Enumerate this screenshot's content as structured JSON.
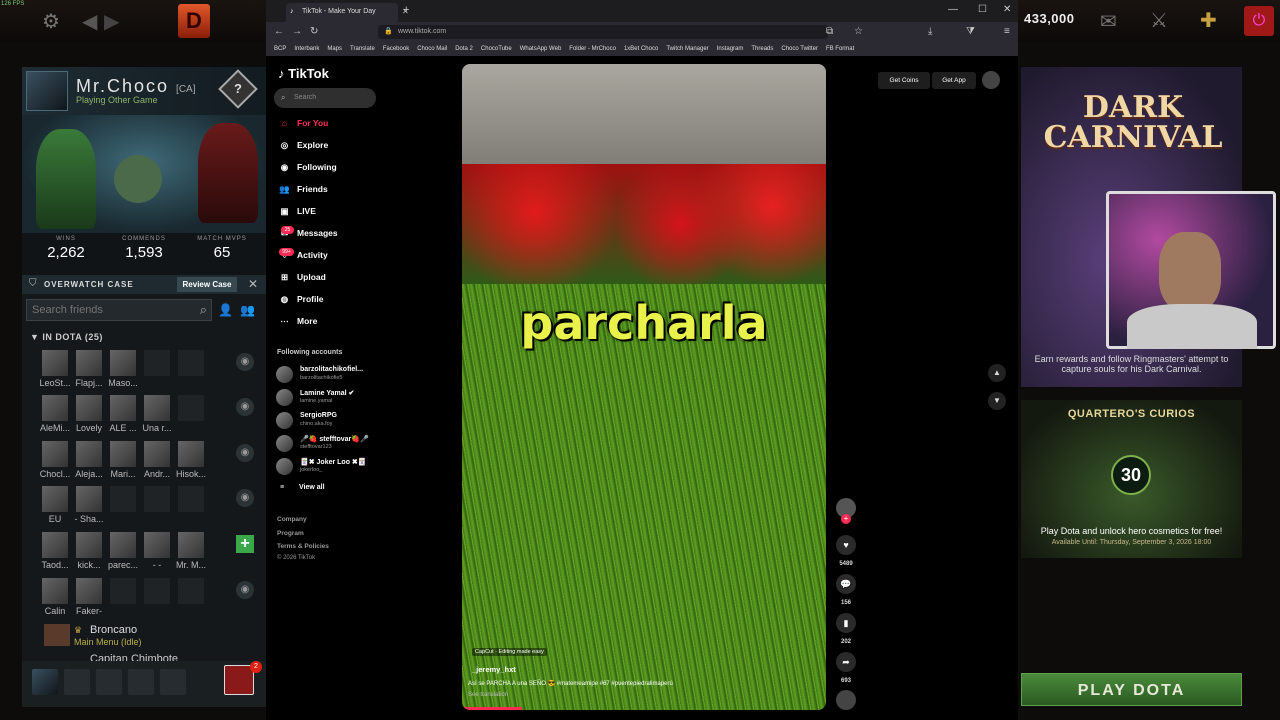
{
  "fps": "126 FPS",
  "dota": {
    "gold": "433,000",
    "profile": {
      "name": "Mr.Choco",
      "tag": "[CA]",
      "status": "Playing Other Game",
      "rank_symbol": "?",
      "stats": [
        {
          "label": "WINS",
          "value": "2,262"
        },
        {
          "label": "COMMENDS",
          "value": "1,593"
        },
        {
          "label": "MATCH MVPS",
          "value": "65"
        }
      ]
    },
    "overwatch": {
      "label": "OVERWATCH CASE",
      "button": "Review Case"
    },
    "search_placeholder": "Search friends",
    "group_label": "IN DOTA (25)",
    "friend_rows": [
      [
        "LeoSt...",
        "Flapj...",
        "Maso..."
      ],
      [
        "AleMi...",
        "Lovely",
        "ALE ...",
        "Una r..."
      ],
      [
        "Chocl...",
        "Aleja...",
        "Mari...",
        "Andr...",
        "Hisok..."
      ],
      [
        "EU",
        "- Sha..."
      ],
      [
        "Taod...",
        "kick...",
        "parec...",
        "- -",
        "Mr. M..."
      ],
      [
        "Calin",
        "Faker-"
      ]
    ],
    "broncano": {
      "name": "Broncano",
      "status": "Main Menu (Idle)"
    },
    "capitan": "Capitan Chimbote",
    "party_badge": "2",
    "carnival": {
      "title_line1": "DARK",
      "title_line2": "CARNIVAL",
      "desc": "Earn rewards and follow Ringmasters' attempt to capture souls for his Dark Carnival."
    },
    "curios": {
      "title": "QUARTERO'S CURIOS",
      "badge": "30",
      "desc": "Play Dota and unlock hero cosmetics for free!",
      "available": "Available Until: Thursday, September 3, 2026 18:00"
    },
    "play_button": "PLAY DOTA"
  },
  "browser": {
    "tab_title": "TikTok - Make Your Day",
    "url": "www.tiktok.com",
    "bookmarks": [
      "BCP",
      "Interbank",
      "Maps",
      "Translate",
      "Facebook",
      "Choco Mail",
      "Dota 2",
      "ChocoTube",
      "WhatsApp Web",
      "Folder - MrChoco",
      "1xBet Choco",
      "Twitch Manager",
      "Instagram",
      "Threads",
      "Choco Twitter",
      "FB Format"
    ]
  },
  "tiktok": {
    "logo": "TikTok",
    "search_placeholder": "Search",
    "nav": [
      "For You",
      "Explore",
      "Following",
      "Friends",
      "LIVE",
      "Messages",
      "Activity",
      "Upload",
      "Profile",
      "More"
    ],
    "messages_badge": "25",
    "activity_badge": "99+",
    "following_header": "Following accounts",
    "following": [
      {
        "name": "barzolitachikofiel...",
        "handle": "barzolitachikofie5"
      },
      {
        "name": "Lamine Yamal ✔",
        "handle": "lamine.yamal"
      },
      {
        "name": "SergioRPG",
        "handle": "chino.aka.foy"
      },
      {
        "name": "🎤🍓 stefftovar🍓🎤",
        "handle": "stefftovar123"
      },
      {
        "name": "🃏✖ Joker Loo ✖🃏",
        "handle": "jokerloo_"
      }
    ],
    "view_all": "View all",
    "footer": [
      "Company",
      "Program",
      "Terms & Policies",
      "© 2026 TikTok"
    ],
    "get_coins": "Get Coins",
    "get_app": "Get App",
    "video": {
      "overlay_text": "parcharla",
      "capcut": "CapCut · Editing made easy",
      "author": "_jeremy_hxt",
      "desc": "Así se PARCHA A una SEÑO 😎 #matemeamipe #67 #puentepiedralimaperú",
      "see_translation": "See translation",
      "likes": "5489",
      "comments": "156",
      "saves": "202",
      "shares": "693"
    }
  }
}
